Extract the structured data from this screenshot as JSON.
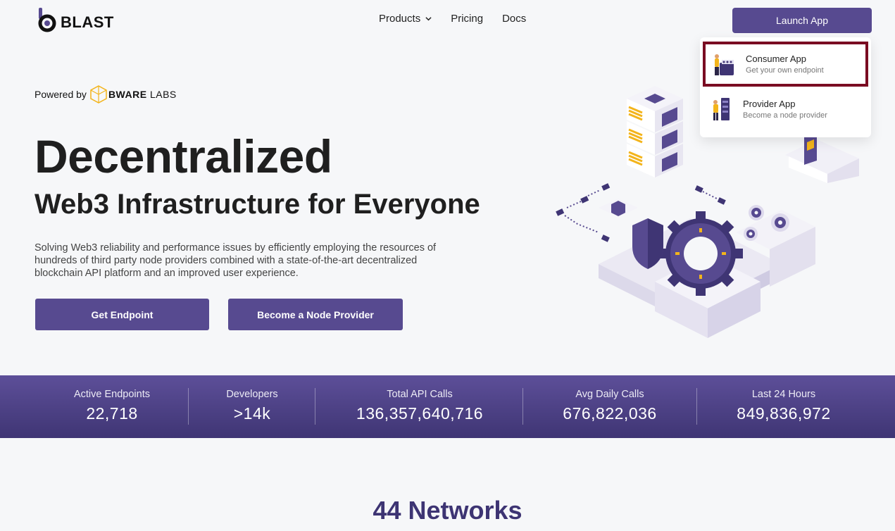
{
  "header": {
    "logo_text": "BLAST",
    "nav": [
      {
        "label": "Products",
        "has_dropdown": true
      },
      {
        "label": "Pricing"
      },
      {
        "label": "Docs"
      }
    ],
    "launch_button": "Launch App"
  },
  "dropdown": {
    "items": [
      {
        "title": "Consumer App",
        "subtitle": "Get your own endpoint",
        "selected": true
      },
      {
        "title": "Provider App",
        "subtitle": "Become a node provider",
        "selected": false
      }
    ]
  },
  "hero": {
    "powered_by": "Powered by",
    "bware_bold": "BWARE",
    "bware_light": "LABS",
    "title": "Decentralized",
    "subtitle": "Web3 Infrastructure for Everyone",
    "description": "Solving Web3 reliability and performance issues by efficiently employing the resources of hundreds of third party node providers combined with a state-of-the-art decentralized blockchain API platform and an improved user experience.",
    "primary_button": "Get Endpoint",
    "secondary_button": "Become a Node Provider"
  },
  "stats": [
    {
      "label": "Active Endpoints",
      "value": "22,718"
    },
    {
      "label": "Developers",
      "value": ">14k"
    },
    {
      "label": "Total API Calls",
      "value": "136,357,640,716"
    },
    {
      "label": "Avg Daily Calls",
      "value": "676,822,036"
    },
    {
      "label": "Last 24 Hours",
      "value": "849,836,972"
    }
  ],
  "networks_heading": "44 Networks",
  "colors": {
    "brand": "#574a90",
    "selected_outline": "#7a0c22",
    "accent_yellow": "#f3b41b"
  }
}
